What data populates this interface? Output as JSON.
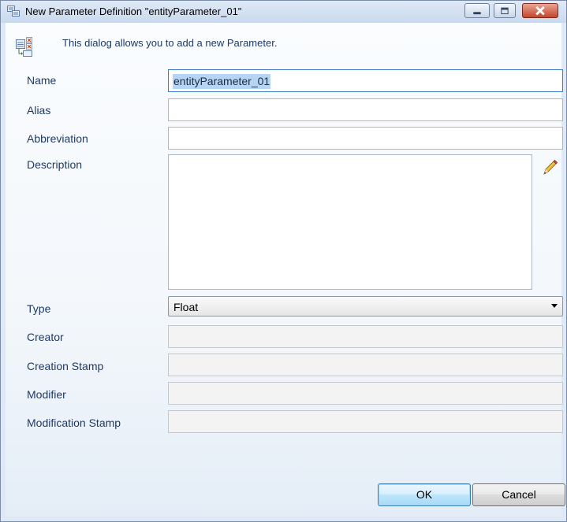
{
  "window": {
    "title": "New Parameter Definition \"entityParameter_01\"",
    "info_text": "This dialog allows you to add a new Parameter."
  },
  "fields": {
    "name": {
      "label": "Name",
      "value": "entityParameter_01"
    },
    "alias": {
      "label": "Alias",
      "value": ""
    },
    "abbreviation": {
      "label": "Abbreviation",
      "value": ""
    },
    "description": {
      "label": "Description",
      "value": ""
    },
    "type": {
      "label": "Type",
      "value": "Float"
    },
    "creator": {
      "label": "Creator",
      "value": ""
    },
    "creation_stamp": {
      "label": "Creation Stamp",
      "value": ""
    },
    "modifier": {
      "label": "Modifier",
      "value": ""
    },
    "modification_stamp": {
      "label": "Modification Stamp",
      "value": ""
    }
  },
  "buttons": {
    "ok": "OK",
    "cancel": "Cancel"
  },
  "icons": {
    "title": "parameter-definition-icon",
    "info": "parameter-checklist-icon",
    "edit": "pencil-icon",
    "minimize": "minimize-icon",
    "maximize": "maximize-icon",
    "close": "close-icon"
  },
  "colors": {
    "label": "#1e3a66",
    "selection": "#b6d4f3",
    "close_button": "#c4452c"
  }
}
